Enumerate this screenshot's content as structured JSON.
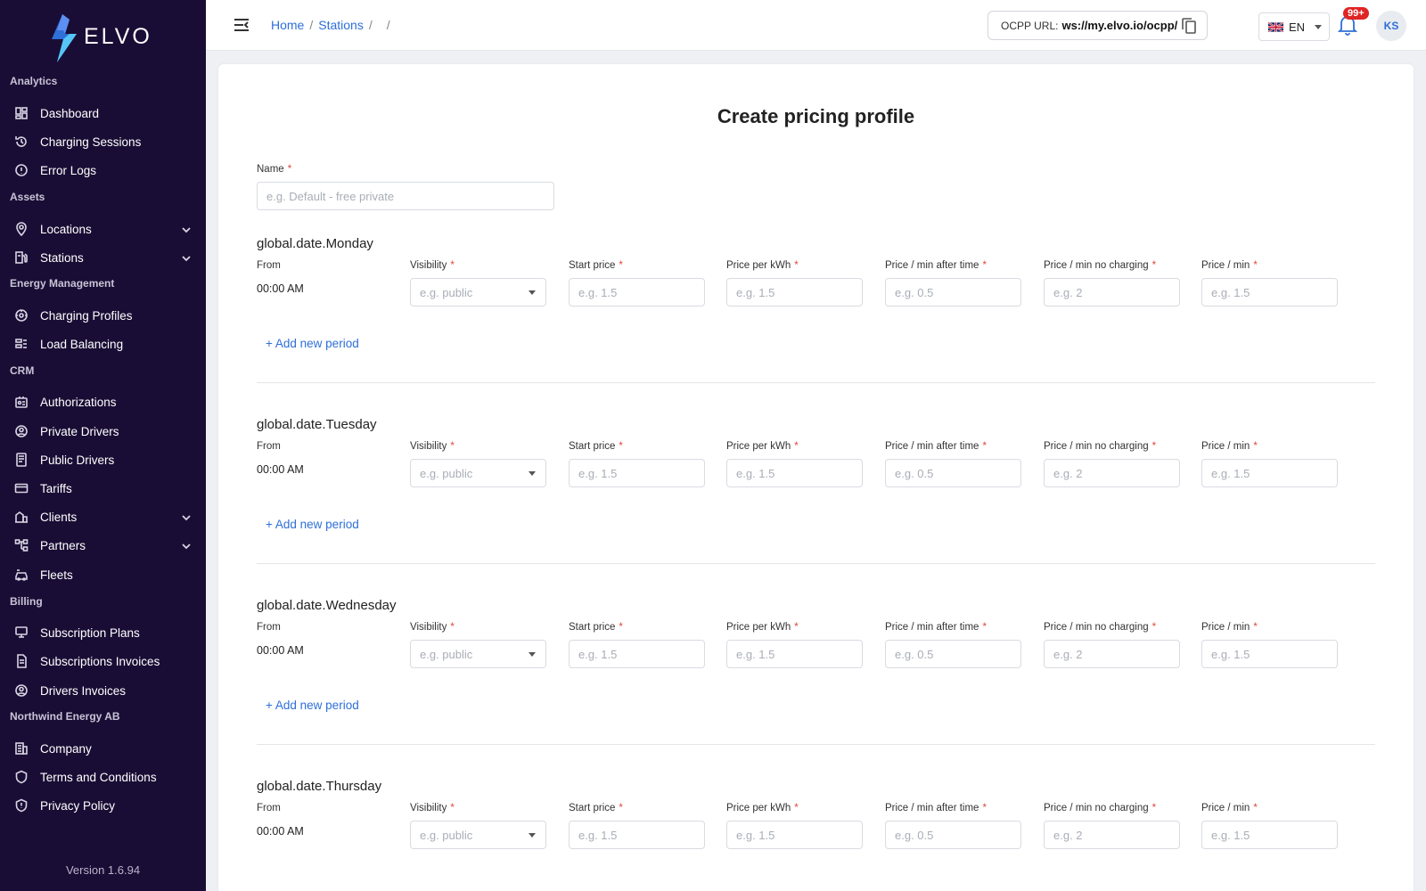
{
  "brand": {
    "name": "ELVO",
    "accent": "#2e6fd8",
    "sidebar_bg": "#1a0d35"
  },
  "sidebar": {
    "sections": [
      {
        "title": "Analytics",
        "items": [
          {
            "label": "Dashboard",
            "icon": "dashboard-icon"
          },
          {
            "label": "Charging Sessions",
            "icon": "history-icon"
          },
          {
            "label": "Error Logs",
            "icon": "alert-circle-icon"
          }
        ]
      },
      {
        "title": "Assets",
        "items": [
          {
            "label": "Locations",
            "icon": "map-pin-icon",
            "expandable": true
          },
          {
            "label": "Stations",
            "icon": "charging-station-icon",
            "expandable": true
          }
        ]
      },
      {
        "title": "Energy Management",
        "items": [
          {
            "label": "Charging Profiles",
            "icon": "gauge-icon"
          },
          {
            "label": "Load Balancing",
            "icon": "load-balancing-icon"
          }
        ]
      },
      {
        "title": "CRM",
        "items": [
          {
            "label": "Authorizations",
            "icon": "id-badge-icon"
          },
          {
            "label": "Private Drivers",
            "icon": "user-circle-icon"
          },
          {
            "label": "Public Drivers",
            "icon": "id-card-icon"
          },
          {
            "label": "Tariffs",
            "icon": "credit-card-icon"
          },
          {
            "label": "Clients",
            "icon": "buildings-icon",
            "expandable": true
          },
          {
            "label": "Partners",
            "icon": "hierarchy-icon",
            "expandable": true
          },
          {
            "label": "Fleets",
            "icon": "car-icon"
          }
        ]
      },
      {
        "title": "Billing",
        "items": [
          {
            "label": "Subscription Plans",
            "icon": "monitor-icon"
          },
          {
            "label": "Subscriptions Invoices",
            "icon": "document-icon"
          },
          {
            "label": "Drivers Invoices",
            "icon": "user-circle-icon"
          }
        ]
      },
      {
        "title": "Northwind Energy AB",
        "items": [
          {
            "label": "Company",
            "icon": "building-icon"
          },
          {
            "label": "Terms and Conditions",
            "icon": "shield-icon"
          },
          {
            "label": "Privacy Policy",
            "icon": "shield-alert-icon"
          }
        ]
      }
    ],
    "version": "Version 1.6.94"
  },
  "topbar": {
    "breadcrumb": [
      "Home",
      "Stations"
    ],
    "ocpp_label": "OCPP URL:",
    "ocpp_url": "ws://my.elvo.io/ocpp/",
    "language": "EN",
    "notifications_badge": "99+",
    "avatar_initials": "KS"
  },
  "form": {
    "title": "Create pricing profile",
    "name_label": "Name",
    "name_placeholder": "e.g. Default - free private",
    "from_label": "From",
    "add_period_label": "+ Add new period",
    "columns": [
      {
        "label": "Visibility",
        "placeholder": "e.g. public",
        "type": "select"
      },
      {
        "label": "Start price",
        "placeholder": "e.g. 1.5",
        "type": "input"
      },
      {
        "label": "Price per kWh",
        "placeholder": "e.g. 1.5",
        "type": "input"
      },
      {
        "label": "Price / min after time",
        "placeholder": "e.g. 0.5",
        "type": "input"
      },
      {
        "label": "Price / min no charging",
        "placeholder": "e.g. 2",
        "type": "input"
      },
      {
        "label": "Price / min",
        "placeholder": "e.g. 1.5",
        "type": "input"
      }
    ],
    "days": [
      {
        "title": "global.date.Monday",
        "from": "00:00 AM"
      },
      {
        "title": "global.date.Tuesday",
        "from": "00:00 AM"
      },
      {
        "title": "global.date.Wednesday",
        "from": "00:00 AM"
      },
      {
        "title": "global.date.Thursday",
        "from": "00:00 AM"
      }
    ]
  }
}
